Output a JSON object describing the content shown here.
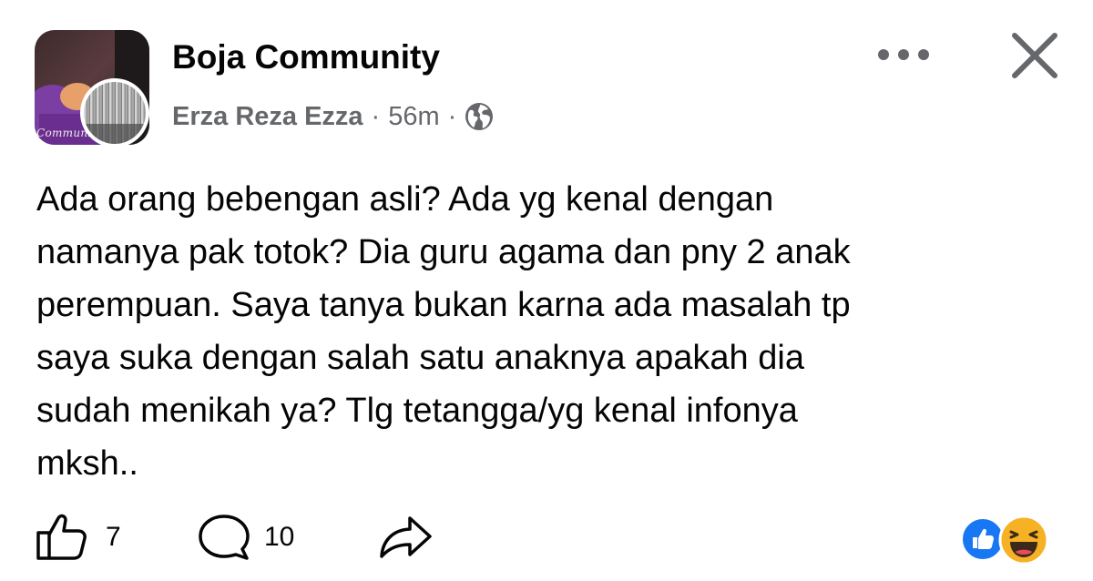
{
  "post": {
    "group_name": "Boja Community",
    "group_avatar_text": "Community",
    "author": "Erza Reza Ezza",
    "separator": "·",
    "time": "56m",
    "privacy_icon": "globe-icon",
    "text": "Ada orang bebengan asli? Ada yg kenal dengan\nnamanya pak totok? Dia guru agama dan pny 2 anak\nperempuan. Saya tanya bukan karna ada masalah tp\nsaya suka dengan salah satu anaknya apakah dia\nsudah menikah ya? Tlg tetangga/yg kenal infonya\nmksh.."
  },
  "header_actions": {
    "more_icon": "more-horizontal-icon",
    "close_icon": "close-icon"
  },
  "footer": {
    "like_count": "7",
    "comment_count": "10",
    "like_icon": "thumbs-up-icon",
    "comment_icon": "comment-bubble-icon",
    "share_icon": "share-arrow-icon",
    "reactions": [
      "like-reaction-icon",
      "haha-reaction-icon"
    ]
  },
  "colors": {
    "primary_text": "#050505",
    "secondary_text": "#65676b",
    "like_blue": "#1877f2",
    "haha_yellow": "#f7b125",
    "background": "#ffffff"
  }
}
